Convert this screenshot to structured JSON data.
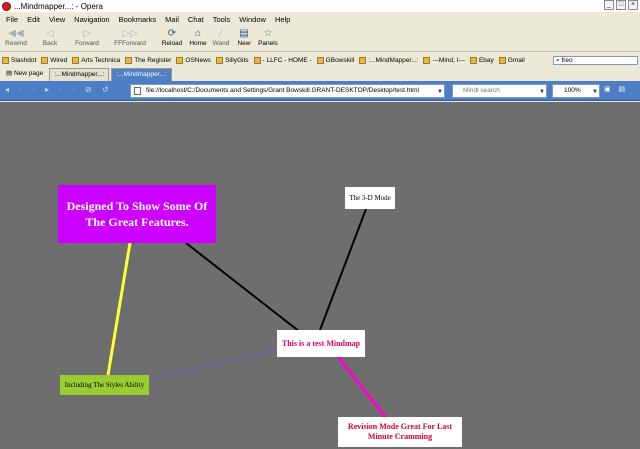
{
  "window": {
    "title": "...Mindmapper...: - Opera",
    "controls": [
      "minimize",
      "maximize",
      "close"
    ]
  },
  "menu": [
    "File",
    "Edit",
    "View",
    "Navigation",
    "Bookmarks",
    "Mail",
    "Chat",
    "Tools",
    "Window",
    "Help"
  ],
  "toolbar": {
    "rewind": "Rewind",
    "back": "Back",
    "forward": "Forward",
    "fastforward": "FFForward",
    "reload": "Reload",
    "home": "Home",
    "wand": "Wand",
    "new": "New",
    "panels": "Panels",
    "search_value": "freo"
  },
  "bookmarks": [
    "Slashdot",
    "Wired",
    "Arts Technica",
    "The Register",
    "OSNews",
    "SillyGits",
    "- LLFC - HOME -",
    "GBowskill",
    ":...MindMapper...:",
    "---Mind, I---",
    "Ebay",
    "Gmail"
  ],
  "tabs": {
    "new_page": "New page",
    "tab1": ":...Mindmapper...:",
    "tab2": ":...Mindmapper...:"
  },
  "address": {
    "url": "file://localhost/C:/Documents and Settings/Grant Bowskill.GRANT-DESKTOP/Desktop/test.html",
    "search_placeholder": "Mindl search",
    "zoom": "100%"
  },
  "mindmap": {
    "nodes": {
      "features": "Designed To Show Some Of The Great Features.",
      "three_d": "The 3-D Mode",
      "center": "This is a test Mindmap",
      "styles": "Including The Styles Ability",
      "revision": "Revision Mode Great For Last Minute Cramming"
    },
    "colors": {
      "background": "#6e6e6e",
      "features_fill": "#cc00ff",
      "styles_fill": "#9acd32",
      "center_text": "#e0005a",
      "revision_text": "#d00033",
      "link_yellow": "#ffff33",
      "link_magenta": "#ff00cc",
      "link_blue": "#6a5acd",
      "link_black": "#000000"
    }
  }
}
